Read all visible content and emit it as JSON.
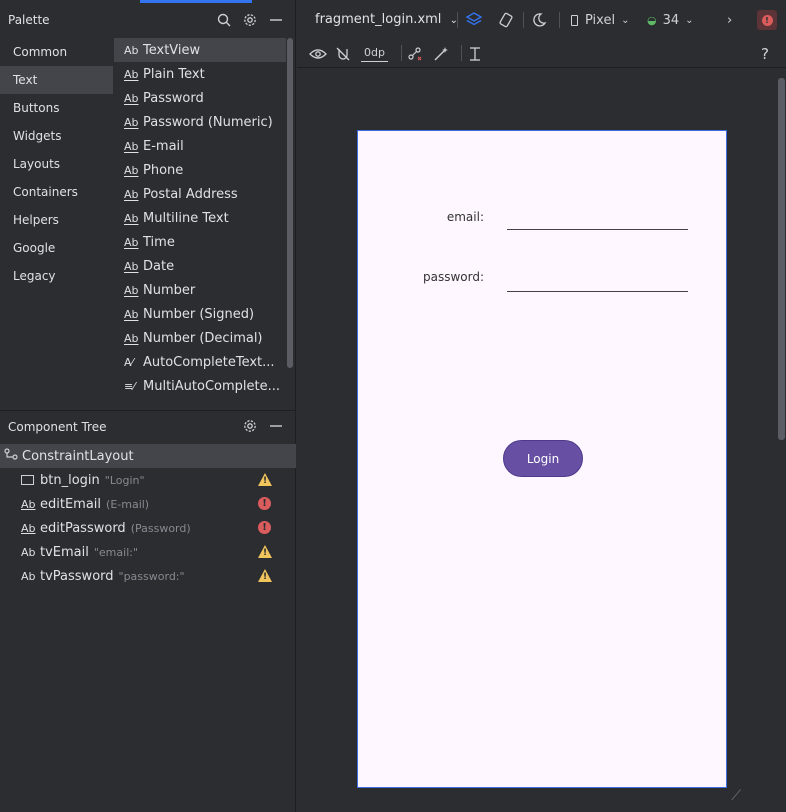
{
  "palette": {
    "title": "Palette",
    "categories": [
      "Common",
      "Text",
      "Buttons",
      "Widgets",
      "Layouts",
      "Containers",
      "Helpers",
      "Google",
      "Legacy"
    ],
    "active_category": "Text",
    "widgets": [
      {
        "icon": "Ab",
        "label": "TextView"
      },
      {
        "icon": "Ab",
        "label": "Plain Text"
      },
      {
        "icon": "Ab",
        "label": "Password"
      },
      {
        "icon": "Ab",
        "label": "Password (Numeric)"
      },
      {
        "icon": "Ab",
        "label": "E-mail"
      },
      {
        "icon": "Ab",
        "label": "Phone"
      },
      {
        "icon": "Ab",
        "label": "Postal Address"
      },
      {
        "icon": "Ab",
        "label": "Multiline Text"
      },
      {
        "icon": "Ab",
        "label": "Time"
      },
      {
        "icon": "Ab",
        "label": "Date"
      },
      {
        "icon": "Ab",
        "label": "Number"
      },
      {
        "icon": "Ab",
        "label": "Number (Signed)"
      },
      {
        "icon": "Ab",
        "label": "Number (Decimal)"
      },
      {
        "icon": "A⁄",
        "label": "AutoCompleteText..."
      },
      {
        "icon": "≡⁄",
        "label": "MultiAutoComplete..."
      }
    ]
  },
  "component_tree": {
    "title": "Component Tree",
    "root": "ConstraintLayout",
    "items": [
      {
        "name": "btn_login",
        "sub": "\"Login\"",
        "status": "warning"
      },
      {
        "name": "editEmail",
        "sub": "(E-mail)",
        "status": "error"
      },
      {
        "name": "editPassword",
        "sub": "(Password)",
        "status": "error"
      },
      {
        "name": "tvEmail",
        "sub": "\"email:\"",
        "status": "warning"
      },
      {
        "name": "tvPassword",
        "sub": "\"password:\"",
        "status": "warning"
      }
    ]
  },
  "editor": {
    "file_name": "fragment_login.xml",
    "device": "Pixel",
    "api_level": "34",
    "margin_value": "0dp",
    "help": "?"
  },
  "preview": {
    "email_label": "email:",
    "password_label": "password:",
    "login_button": "Login"
  },
  "colors": {
    "accent": "#3574f0",
    "login_button": "#6750a4",
    "warning": "#f2c55c",
    "error": "#db5c5c"
  }
}
